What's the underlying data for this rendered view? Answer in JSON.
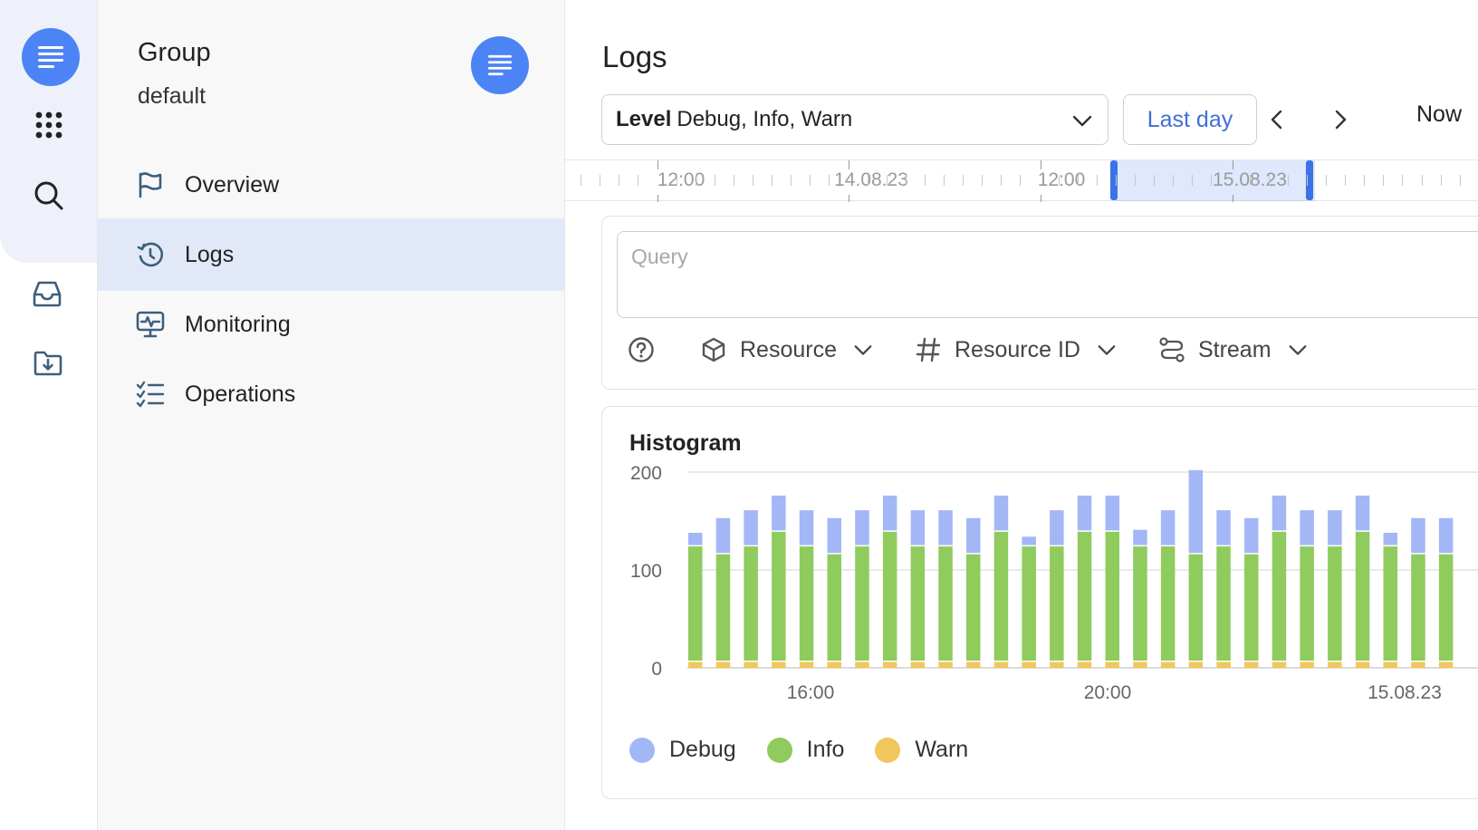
{
  "rail": {
    "icons": [
      "logs-app-icon",
      "apps-grid-icon",
      "search-icon",
      "inbox-icon",
      "folder-download-icon"
    ]
  },
  "sidebar": {
    "title": "Group",
    "subtitle": "default",
    "items": [
      {
        "label": "Overview",
        "icon": "flag-icon",
        "active": false
      },
      {
        "label": "Logs",
        "icon": "history-icon",
        "active": true
      },
      {
        "label": "Monitoring",
        "icon": "monitor-pulse-icon",
        "active": false
      },
      {
        "label": "Operations",
        "icon": "checklist-icon",
        "active": false
      }
    ]
  },
  "main": {
    "title": "Logs",
    "level_label": "Level",
    "level_value": "Debug, Info, Warn",
    "range_button": "Last day",
    "now_button": "Now"
  },
  "timeline": {
    "labels": [
      "12:00",
      "14.08.23",
      "12:00",
      "15.08.23"
    ]
  },
  "query": {
    "placeholder": "Query",
    "filters": [
      {
        "label": "Resource",
        "icon": "cube-icon"
      },
      {
        "label": "Resource ID",
        "icon": "hash-icon"
      },
      {
        "label": "Stream",
        "icon": "stream-icon"
      }
    ]
  },
  "colors": {
    "accent": "#4d84f5",
    "debug": "#a3b7f7",
    "info": "#8fcb5d",
    "warn": "#f1c75b"
  },
  "chart_data": {
    "type": "bar",
    "stacked": true,
    "title": "Histogram",
    "ylim": [
      0,
      200
    ],
    "y_ticks": [
      0,
      100,
      200
    ],
    "x_tick_labels": [
      "16:00",
      "20:00",
      "15.08.23"
    ],
    "grid": true,
    "legend": "bottom-left",
    "series": [
      {
        "name": "Debug",
        "values": [
          14,
          37,
          37,
          37,
          37,
          37,
          37,
          37,
          37,
          37,
          37,
          37,
          10,
          37,
          37,
          37,
          17,
          37,
          86,
          37,
          37,
          37,
          37,
          37,
          37,
          14,
          37,
          37
        ]
      },
      {
        "name": "Info",
        "values": [
          118,
          110,
          118,
          133,
          118,
          110,
          118,
          133,
          118,
          118,
          110,
          133,
          118,
          118,
          133,
          133,
          118,
          118,
          110,
          118,
          110,
          133,
          118,
          118,
          133,
          118,
          110,
          110
        ]
      },
      {
        "name": "Warn",
        "values": [
          6,
          6,
          6,
          6,
          6,
          6,
          6,
          6,
          6,
          6,
          6,
          6,
          6,
          6,
          6,
          6,
          6,
          6,
          6,
          6,
          6,
          6,
          6,
          6,
          6,
          6,
          6,
          6
        ]
      }
    ]
  }
}
